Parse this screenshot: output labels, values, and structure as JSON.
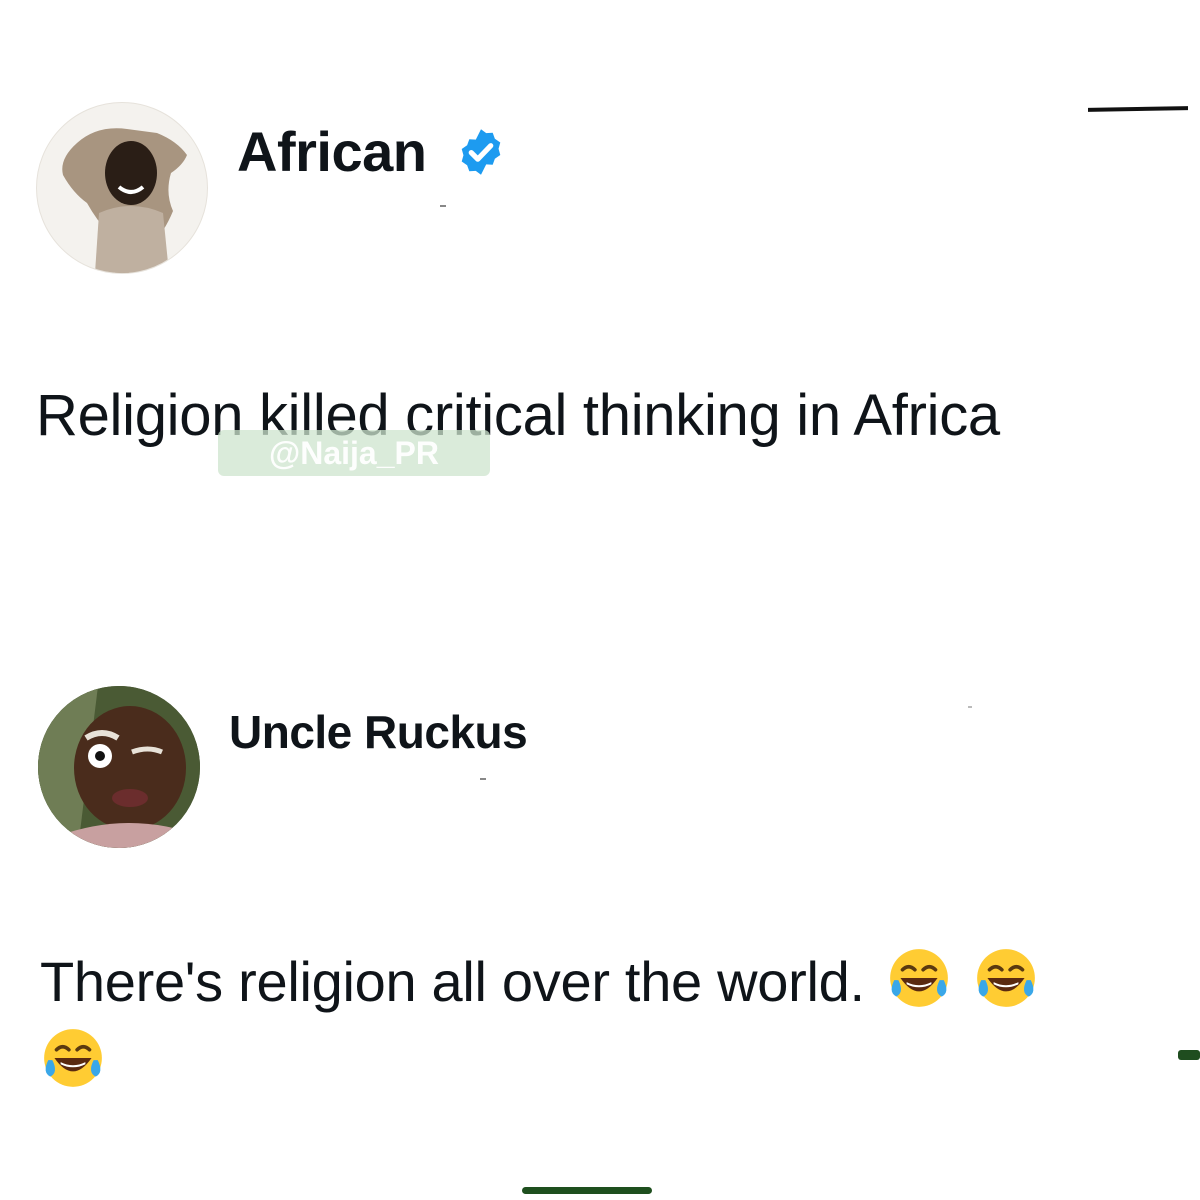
{
  "posts": [
    {
      "author": "African",
      "verified": true,
      "avatar_icon": "avatar-africa-portrait",
      "text": "Religion killed critical thinking in Africa"
    },
    {
      "author": "Uncle Ruckus",
      "verified": false,
      "avatar_icon": "avatar-cartoon-character",
      "text_line_1": "There's religion all over the world.",
      "text_line_2": "",
      "emoji": "face-with-tears-of-joy"
    }
  ],
  "watermark": "@Naija_PR",
  "colors": {
    "verified_badge": "#1d9bf0",
    "text": "#0f1419",
    "watermark_bg": "#cde4cd",
    "home_indicator": "#1e4f1e"
  }
}
